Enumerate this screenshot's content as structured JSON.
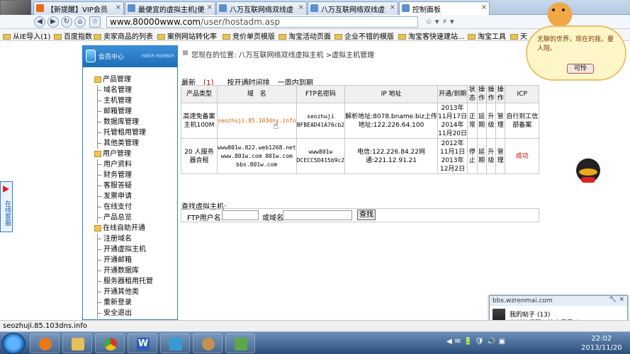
{
  "browser": {
    "tabs": [
      {
        "label": "【新提醒】VIP会员",
        "color": "#e86a1a"
      },
      {
        "label": "最便宜的虚拟主机|便",
        "color": "#5a8fd0"
      },
      {
        "label": "八万互联网络双线虚",
        "color": "#5a8fd0"
      },
      {
        "label": "八万互联网络双线虚",
        "color": "#5a8fd0"
      },
      {
        "label": "控制面板",
        "color": "#5a8fd0"
      }
    ],
    "url_host": "www.80000www.com",
    "url_path": "/user/hostadm.asp",
    "bookmarks": [
      "从IE导入(1)",
      "百度指数",
      "卖家商品的列表",
      "案例网站转化率",
      "竞价单页模版",
      "淘宝活动页面",
      "企业不错的模版",
      "淘宝客快速建站...",
      "淘宝工具",
      "天"
    ]
  },
  "sidebar": {
    "title": "会员中心",
    "subtitle": "HIBER MEMBER",
    "groups": [
      {
        "label": "产品管理",
        "items": [
          "域名管理",
          "主机管理",
          "邮箱管理",
          "数据库管理",
          "托管租用管理",
          "其他类管理"
        ]
      },
      {
        "label": "用户管理",
        "items": [
          "用户资料",
          "财务管理",
          "客服答疑",
          "发票申请",
          "在线支付",
          "产品总览"
        ]
      },
      {
        "label": "在线自助开通",
        "items": [
          "注册域名",
          "开通虚拟主机",
          "开通邮箱",
          "开通数据库",
          "服务器租用托管",
          "开通其他类",
          "重新登录",
          "安全退出"
        ]
      }
    ]
  },
  "kefu": "在线客服",
  "breadcrumb": "您现在的位置: 八万互联网络双线虚拟主机 >虚拟主机管理",
  "filter": {
    "latest": "最新",
    "count": "[1]",
    "sort_time": "按开通时间排",
    "within_week": "一周内到期"
  },
  "table": {
    "headers": [
      "产品类型",
      "域　名",
      "FTP名密码",
      "IP 地址",
      "开通/到期",
      "状态",
      "操作",
      "操作",
      "操作",
      "ICP"
    ],
    "rows": [
      {
        "type": "高速免备案主机100M",
        "domain": "seozhuji.85.103dns.info",
        "ftp": "seozhuji BFBEAD41A76cb2",
        "ip": "解析地址:8078.bname.biz上传地址:122.226.64.100",
        "dates": "2013年11月17日 2014年11月20日",
        "status": "正常",
        "op1": "延期",
        "op2": "升级",
        "op3": "管理",
        "icp": "自行到工信部备案"
      },
      {
        "type": "20 人服务器合租",
        "domain": "www801w.822.web1268.net www.801w.com 801w.com bbs.801w.com",
        "ftp": "www801w DCECC5D415b9c2",
        "ip": "电信:122.226.84.22网通:221.12.91.21",
        "dates": "2012年11月1日 2013年12月2日",
        "status": "停止",
        "op1": "延期",
        "op2": "升级",
        "op3": "管理",
        "icp": "成功"
      }
    ]
  },
  "search": {
    "title": "查找虚拟主机:",
    "ftp_label": "FTP用户名:",
    "domain_label": "或域名",
    "button": "查找"
  },
  "mascot": {
    "message": "无聊的世界，现在的我，要人陪。",
    "button": "可怜"
  },
  "notification": {
    "site": "bbs.wzrenmai.com",
    "line1": "我的帖子 (13)",
    "line2": "有新的提醒，快去看看吧"
  },
  "status_url": "seozhuji.85.103dns.info",
  "clock": {
    "time": "22:02",
    "date": "2013/11/20"
  },
  "taskbar_apps": [
    {
      "name": "firefox",
      "color": "#e8781a"
    },
    {
      "name": "explorer",
      "color": "#e6c05a"
    },
    {
      "name": "chrome",
      "color": "#d8352a"
    },
    {
      "name": "word",
      "color": "#2a5fb8"
    },
    {
      "name": "remote-desktop",
      "color": "#3a9ad8"
    },
    {
      "name": "users",
      "color": "#c89050"
    },
    {
      "name": "media",
      "color": "#5aa84a"
    }
  ]
}
